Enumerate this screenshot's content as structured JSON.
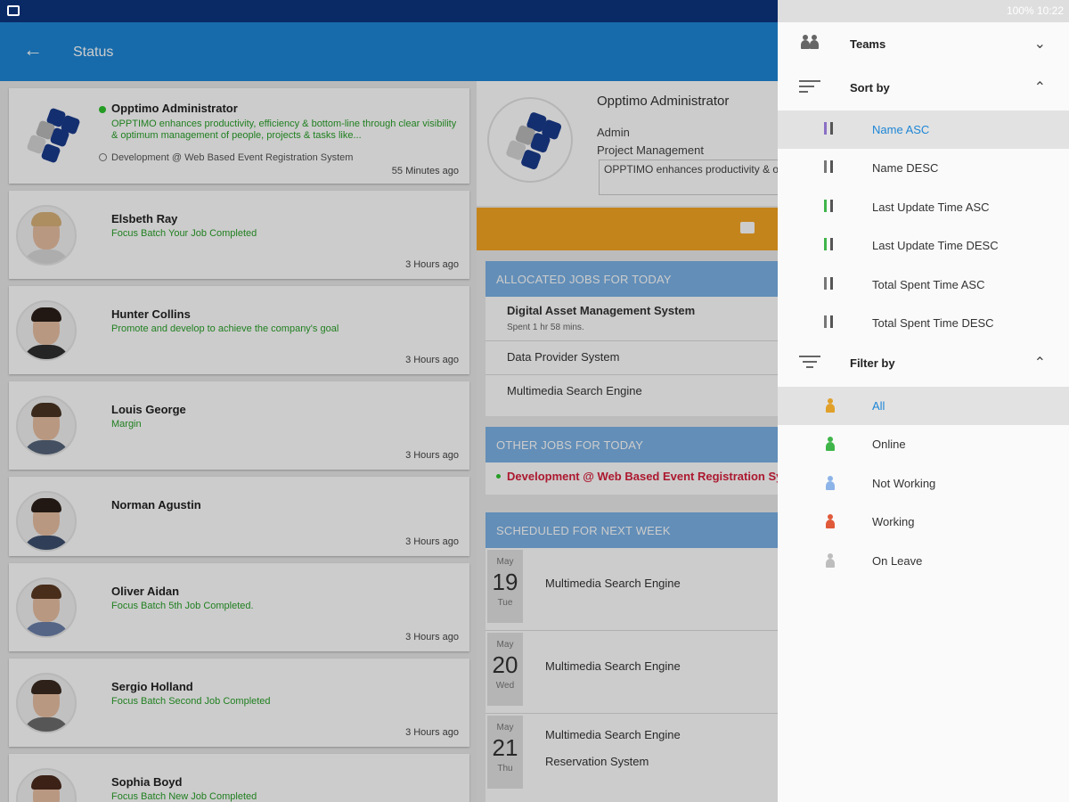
{
  "status_bar": {
    "right_text": "100% 10:22"
  },
  "appbar": {
    "title": "Status",
    "back_icon": "arrow-left-icon"
  },
  "admin_card": {
    "name": "Opptimo Administrator",
    "description": "OPPTIMO enhances productivity, efficiency & bottom-line through clear visibility & optimum management of people, projects & tasks like...",
    "project": "Development @ Web Based Event Registration System",
    "time": "55 Minutes ago"
  },
  "users": [
    {
      "name": "Elsbeth Ray",
      "message": "Focus Batch Your Job Completed",
      "time": "3 Hours ago"
    },
    {
      "name": "Hunter Collins",
      "message": "Promote and develop to achieve the company's goal",
      "time": "3 Hours ago"
    },
    {
      "name": "Louis George",
      "message": "Margin",
      "time": "3 Hours ago"
    },
    {
      "name": "Norman Agustin",
      "message": "",
      "time": "3 Hours ago"
    },
    {
      "name": "Oliver Aidan",
      "message": "Focus Batch 5th Job Completed.",
      "time": "3 Hours ago"
    },
    {
      "name": "Sergio Holland",
      "message": "Focus Batch Second Job Completed",
      "time": "3 Hours ago"
    },
    {
      "name": "Sophia Boyd",
      "message": "Focus Batch New Job Completed",
      "time": ""
    }
  ],
  "detail": {
    "name": "Opptimo Administrator",
    "role": "Admin",
    "department": "Project Management",
    "description": "OPPTIMO enhances productivity & optimum management of people",
    "allocated_header": "ALLOCATED JOBS FOR TODAY",
    "allocated_jobs": [
      {
        "title": "Digital Asset Management System",
        "sub": "Spent 1 hr 58 mins."
      },
      {
        "title": "Data Provider System",
        "sub": ""
      },
      {
        "title": "Multimedia Search Engine",
        "sub": ""
      }
    ],
    "other_header": "OTHER JOBS FOR TODAY",
    "other_job": "Development @ Web Based Event Registration System",
    "scheduled_header": "SCHEDULED FOR NEXT WEEK",
    "scheduled": [
      {
        "month": "May",
        "day": "19",
        "weekday": "Tue",
        "jobs": [
          "Multimedia Search Engine"
        ]
      },
      {
        "month": "May",
        "day": "20",
        "weekday": "Wed",
        "jobs": [
          "Multimedia Search Engine"
        ]
      },
      {
        "month": "May",
        "day": "21",
        "weekday": "Thu",
        "jobs": [
          "Multimedia Search Engine",
          "Reservation System"
        ]
      }
    ]
  },
  "drawer": {
    "teams_label": "Teams",
    "sort_label": "Sort by",
    "filter_label": "Filter by",
    "sort_options": [
      "Name ASC",
      "Name DESC",
      "Last Update Time ASC",
      "Last Update Time DESC",
      "Total Spent Time ASC",
      "Total Spent Time DESC"
    ],
    "filter_options": [
      "All",
      "Online",
      "Not Working",
      "Working",
      "On Leave"
    ],
    "selected_sort": "Name ASC",
    "selected_filter": "All"
  },
  "colors": {
    "primary": "#1d86d6",
    "accent_orange": "#f6a623",
    "online_green": "#2ec42e",
    "other_job_red": "#d8203c",
    "logo_navy": "#1a3b8c"
  }
}
